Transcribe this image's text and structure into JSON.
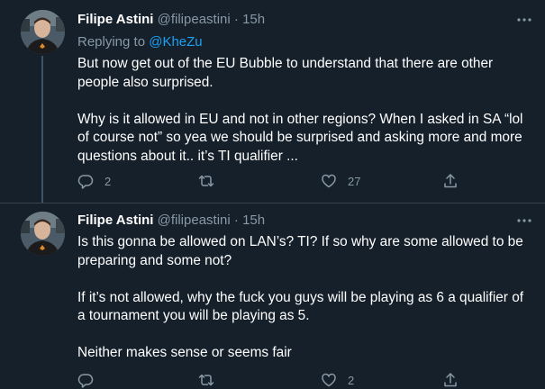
{
  "tweets": [
    {
      "author": "Filipe Astini",
      "handle": "@filipeastini",
      "separator": "·",
      "time": "15h",
      "replying_prefix": "Replying to",
      "replying_to": "@KheZu",
      "paragraphs": [
        "But now get out of the EU Bubble to understand that there are other people also surprised.",
        "Why is it allowed in EU and not in other regions? When I asked in SA “lol of course not” so yea we should be surprised and asking more and more questions about it.. it’s TI qualifier ..."
      ],
      "reply_count": "2",
      "retweet_count": "",
      "like_count": "27"
    },
    {
      "author": "Filipe Astini",
      "handle": "@filipeastini",
      "separator": "·",
      "time": "15h",
      "paragraphs": [
        "Is this gonna be allowed on LAN’s? TI? If so why are some allowed to be preparing and some not?",
        "If it’s not allowed, why the fuck you guys will be playing as 6 a qualifier of a tournament you will be playing as 5.",
        "Neither makes sense or seems fair"
      ],
      "reply_count": "",
      "retweet_count": "",
      "like_count": "2"
    }
  ],
  "icons": {
    "more": "more-horizontal-icon",
    "reply": "reply-icon",
    "retweet": "retweet-icon",
    "like": "heart-icon",
    "share": "share-icon"
  },
  "colors": {
    "background": "#15202b",
    "text": "#ffffff",
    "muted": "#8899a6",
    "link": "#1da1f2",
    "thread_line": "#3d5466",
    "divider": "#38444d"
  }
}
